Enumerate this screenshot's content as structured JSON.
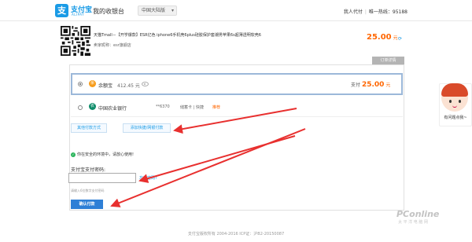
{
  "header": {
    "logo_glyph": "支",
    "logo_name": "支付宝",
    "logo_sub": "ALIPAY",
    "cashier_title": "我的收银台",
    "region": "中国大陆版",
    "user_label": "我人代付",
    "hotline": "唯一热线：95188"
  },
  "order": {
    "title": "天猫Tmall－【开学爆款】ESR亿色 iphone6手机壳6plus硅胶保护套潮男苹果6s超薄透明软壳6",
    "seller": "卖家昵称：esr旗舰店",
    "amount": "25.00",
    "amount_unit": "元",
    "refresh_icon": "refresh-icon",
    "detail_button": "订单详情"
  },
  "payment": {
    "selected_method": {
      "icon_glyph": "余",
      "name": "余额宝",
      "balance": "412.45 元",
      "pay_label": "支付",
      "pay_amount": "25.00",
      "pay_unit": "元"
    },
    "bank_method": {
      "icon_glyph": "农",
      "name": "中国农业银行",
      "tail": "**6370",
      "card_type": "储蓄卡 | 快捷",
      "recommend": "推荐"
    },
    "other_methods_button": "其他付款方式",
    "add_card_button": "添加快捷/网银付款",
    "secure_text": "你在安全的环境中，请放心使用!",
    "password_label": "支付宝支付密码:",
    "forgot_link": "忘记密码?",
    "password_hint": "请输入6位数字支付密码",
    "confirm_button": "确认付款"
  },
  "side": {
    "label": "有问题点我~"
  },
  "footer": {
    "copyright": "支付宝版权所有 2004-2016 ICP证：沪B2-20150087"
  },
  "watermark": {
    "main": "PConline",
    "sub": "太 平 洋 电 脑 网"
  },
  "colors": {
    "brand": "#1a9be6",
    "accent": "#f60",
    "confirm": "#2e7fd6",
    "arrow": "#e8302f"
  }
}
